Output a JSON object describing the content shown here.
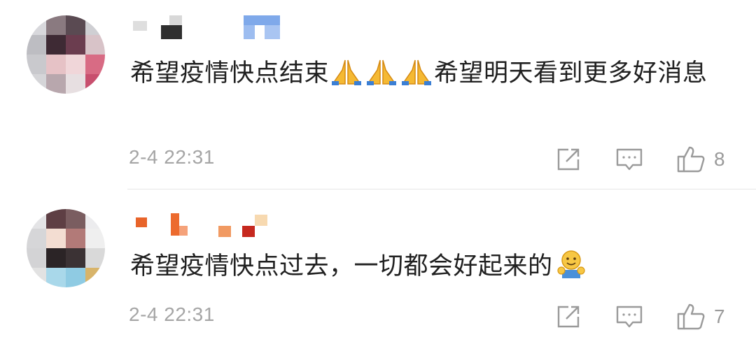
{
  "comments": [
    {
      "text_part1": "希望疫情快点结束",
      "emoji": "pray-emoji",
      "text_part2": "希望明天看到更多好消息",
      "timestamp": "2-4 22:31",
      "like_count": "8"
    },
    {
      "text": "希望疫情快点过去，一切都会好起来的",
      "emoji": "hug-emoji",
      "timestamp": "2-4 22:31",
      "like_count": "7"
    }
  ],
  "icons": {
    "share": "share-icon",
    "reply": "comment-icon",
    "like": "thumbs-up-icon"
  },
  "colors": {
    "text": "#202020",
    "meta": "#a5a5a5",
    "icon": "#9a9a9a",
    "divider": "#e6e6e6"
  }
}
